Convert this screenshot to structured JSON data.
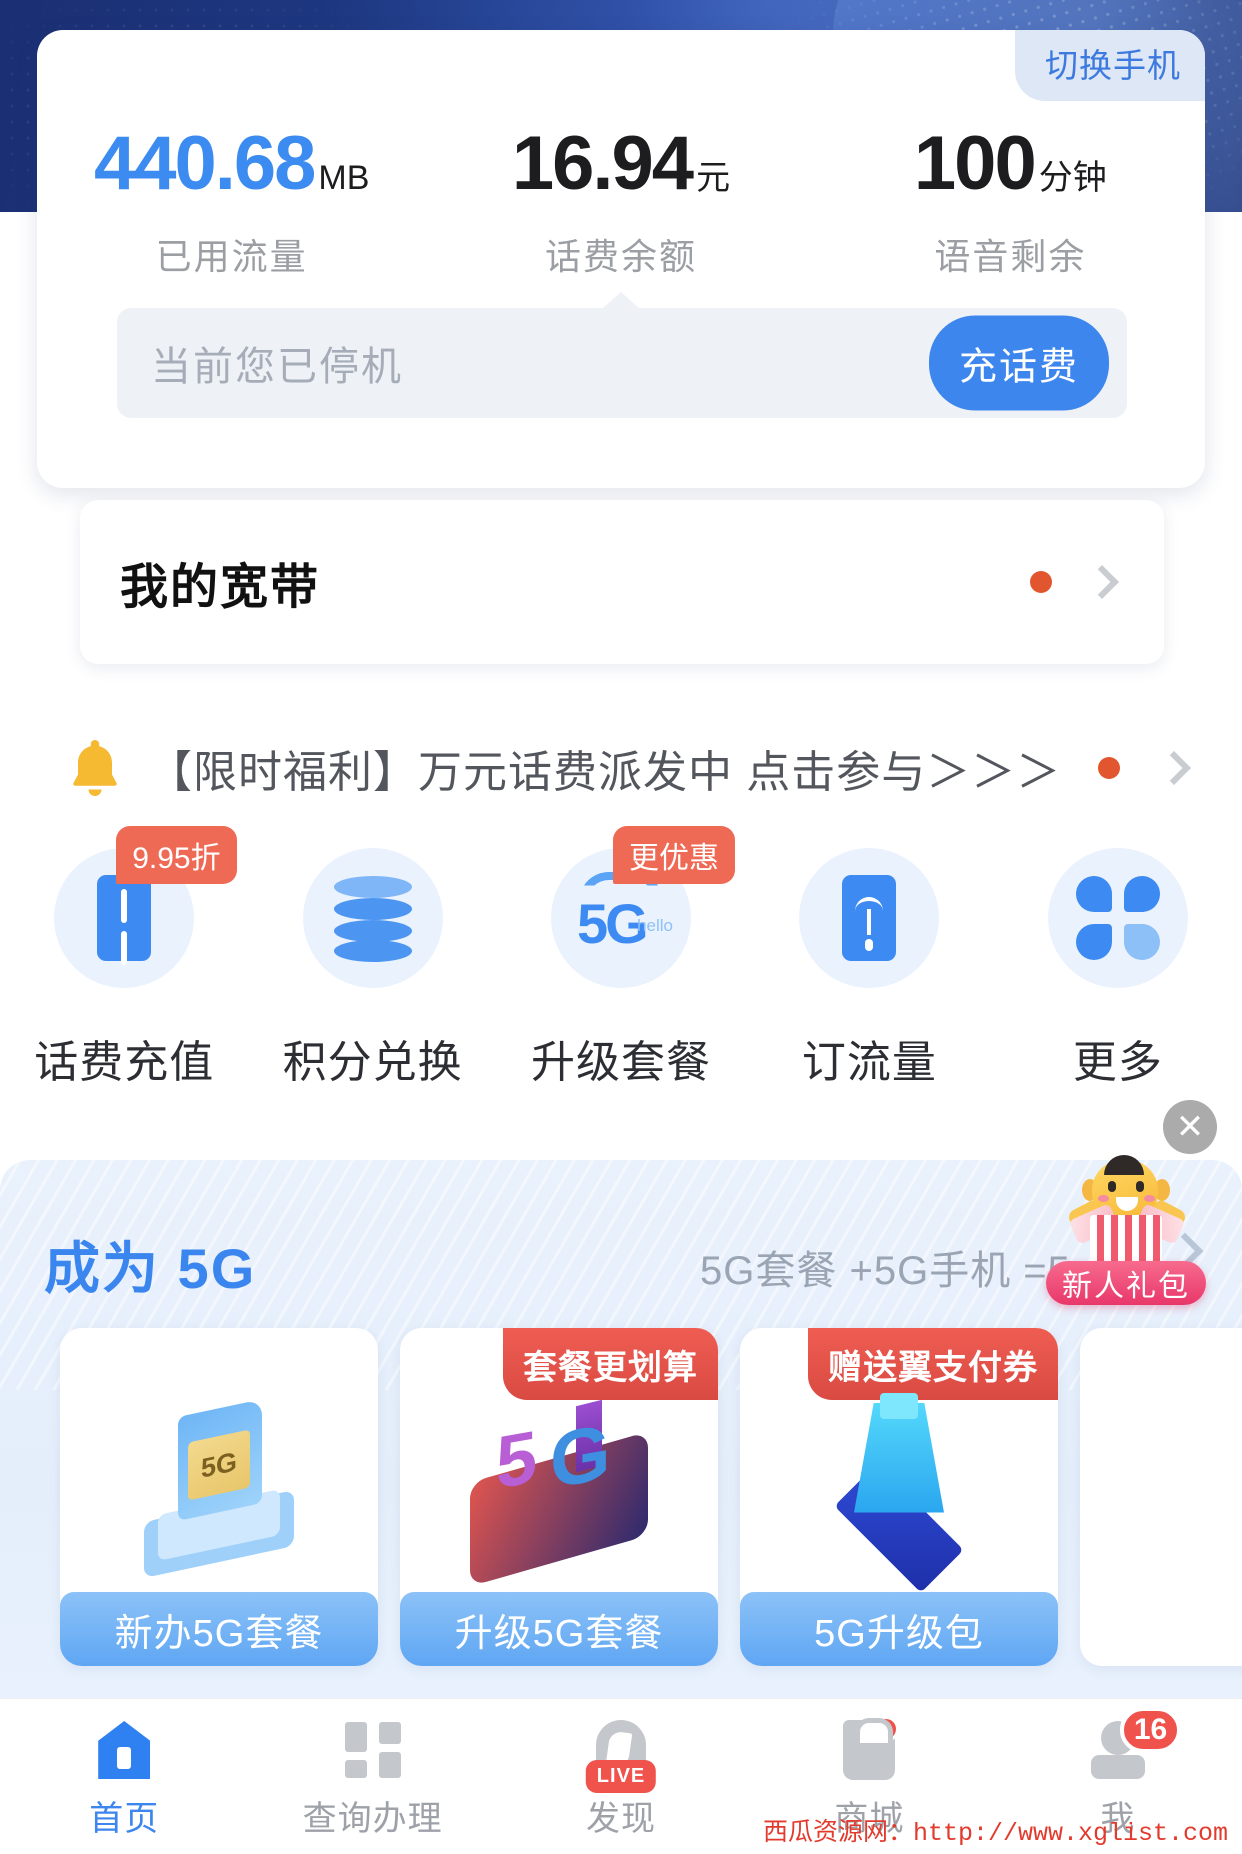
{
  "banner": {
    "accent_color": "#1e3a84"
  },
  "account": {
    "switch_phone_label": "切换手机",
    "stats": [
      {
        "value": "440.68",
        "unit": "MB",
        "label": "已用流量",
        "color": "#3c8bf0"
      },
      {
        "value": "16.94",
        "unit": "元",
        "label": "话费余额",
        "color": "#1d1d1f"
      },
      {
        "value": "100",
        "unit": "分钟",
        "label": "语音剩余",
        "color": "#1d1d1f"
      }
    ],
    "status_text": "当前您已停机",
    "recharge_label": "充话费"
  },
  "broadband": {
    "title": "我的宽带",
    "has_dot": true
  },
  "notice": {
    "icon": "bell-icon",
    "text": "【限时福利】万元话费派发中 点击参与＞＞＞",
    "has_dot": true
  },
  "quick_actions": [
    {
      "label": "话费充值",
      "badge": "9.95折",
      "icon": "phone-recharge-icon"
    },
    {
      "label": "积分兑换",
      "badge": "",
      "icon": "coin-stack-icon"
    },
    {
      "label": "升级套餐",
      "badge": "更优惠",
      "icon": "five-g-home-icon"
    },
    {
      "label": "订流量",
      "badge": "",
      "icon": "signal-phone-icon"
    },
    {
      "label": "更多",
      "badge": "",
      "icon": "grid-more-icon"
    }
  ],
  "promo": {
    "title": "成为 5G",
    "subtitle": "5G套餐 +5G手机 =5",
    "cards": [
      {
        "cta": "新办5G套餐",
        "ribbon": "",
        "art": "sim-card-art"
      },
      {
        "cta": "升级5G套餐",
        "ribbon": "套餐更划算",
        "art": "city-phone-art"
      },
      {
        "cta": "5G升级包",
        "ribbon": "赠送翼支付券",
        "art": "tower-art"
      },
      {
        "cta": "",
        "ribbon": "",
        "art": ""
      }
    ]
  },
  "float_ad": {
    "badge_label": "新人礼包",
    "close_label": "✕"
  },
  "nav": [
    {
      "label": "首页",
      "icon": "home-icon",
      "active": true,
      "badge": ""
    },
    {
      "label": "查询办理",
      "icon": "grid-icon",
      "active": false,
      "badge": ""
    },
    {
      "label": "发现",
      "icon": "discover-icon",
      "active": false,
      "badge": "LIVE"
    },
    {
      "label": "商城",
      "icon": "shop-bag-icon",
      "active": false,
      "badge": "dot"
    },
    {
      "label": "我",
      "icon": "person-icon",
      "active": false,
      "badge": "16"
    }
  ],
  "watermark": "西瓜资源网：http://www.xglist.com"
}
